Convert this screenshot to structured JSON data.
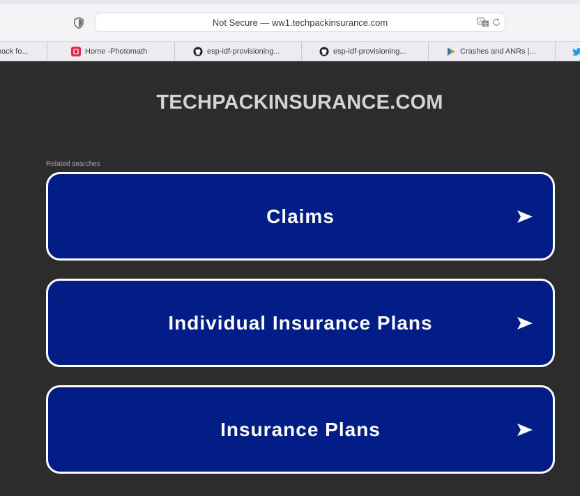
{
  "browser": {
    "address": "Not Secure — ww1.techpackinsurance.com",
    "bookmarks": [
      {
        "label": "pack fo...",
        "icon": "unknown-favicon-icon"
      },
      {
        "label": "Home -Photomath",
        "icon": "photomath-favicon-icon"
      },
      {
        "label": "esp-idf-provisioning...",
        "icon": "github-icon"
      },
      {
        "label": "esp-idf-provisioning...",
        "icon": "github-icon"
      },
      {
        "label": "Crashes and ANRs |...",
        "icon": "play-console-icon"
      },
      {
        "label": "",
        "icon": "twitter-icon"
      }
    ]
  },
  "page": {
    "title": "TECHPACKINSURANCE.COM",
    "related_label": "Related searches",
    "searches": [
      {
        "label": "Claims"
      },
      {
        "label": "Individual Insurance Plans"
      },
      {
        "label": "Insurance Plans"
      }
    ]
  },
  "colors": {
    "page_bg": "#2c2c2c",
    "button_bg": "#021e86",
    "button_border": "#ffffff",
    "title_text": "#d4d4d4"
  }
}
